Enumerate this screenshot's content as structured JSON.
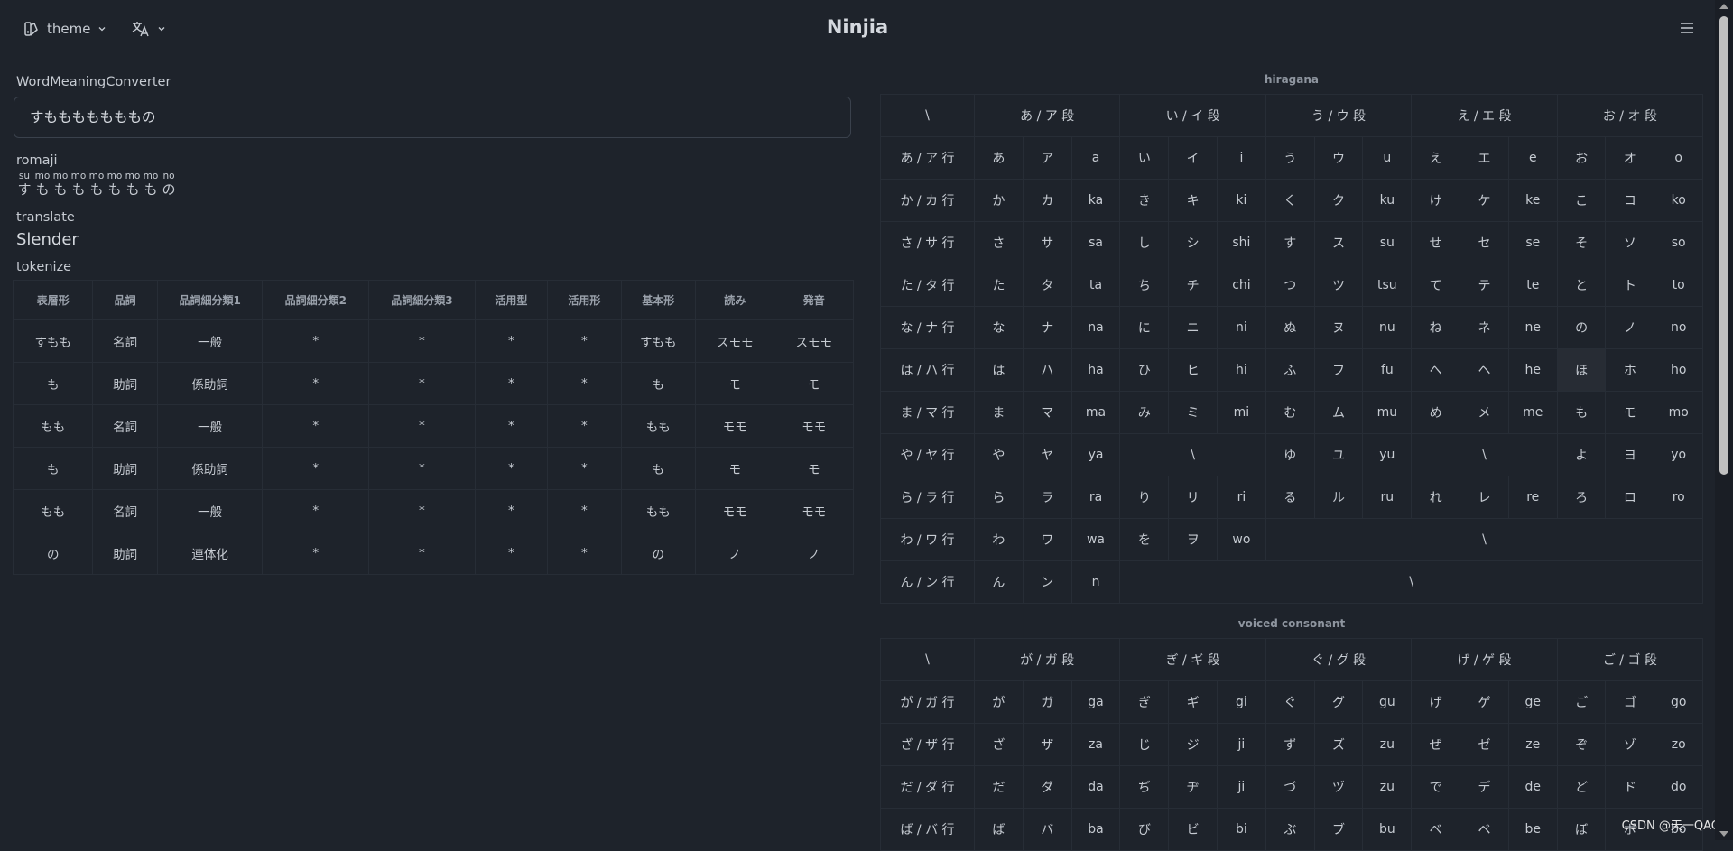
{
  "header": {
    "theme_label": "theme",
    "brand": "Ninjia"
  },
  "converter": {
    "title": "WordMeaningConverter",
    "input_value": "すもももももももの",
    "romaji_label": "romaji",
    "romaji": [
      {
        "rt": "su",
        "k": "す"
      },
      {
        "rt": "mo",
        "k": "も"
      },
      {
        "rt": "mo",
        "k": "も"
      },
      {
        "rt": "mo",
        "k": "も"
      },
      {
        "rt": "mo",
        "k": "も"
      },
      {
        "rt": "mo",
        "k": "も"
      },
      {
        "rt": "mo",
        "k": "も"
      },
      {
        "rt": "mo",
        "k": "も"
      },
      {
        "rt": "no",
        "k": "の"
      }
    ],
    "translate_label": "translate",
    "translation": "Slender",
    "tokenize_label": "tokenize"
  },
  "tokenize": {
    "headers": [
      "表層形",
      "品詞",
      "品詞細分類1",
      "品詞細分類2",
      "品詞細分類3",
      "活用型",
      "活用形",
      "基本形",
      "読み",
      "発音"
    ],
    "rows": [
      [
        "すもも",
        "名詞",
        "一般",
        "*",
        "*",
        "*",
        "*",
        "すもも",
        "スモモ",
        "スモモ"
      ],
      [
        "も",
        "助詞",
        "係助詞",
        "*",
        "*",
        "*",
        "*",
        "も",
        "モ",
        "モ"
      ],
      [
        "もも",
        "名詞",
        "一般",
        "*",
        "*",
        "*",
        "*",
        "もも",
        "モモ",
        "モモ"
      ],
      [
        "も",
        "助詞",
        "係助詞",
        "*",
        "*",
        "*",
        "*",
        "も",
        "モ",
        "モ"
      ],
      [
        "もも",
        "名詞",
        "一般",
        "*",
        "*",
        "*",
        "*",
        "もも",
        "モモ",
        "モモ"
      ],
      [
        "の",
        "助詞",
        "連体化",
        "*",
        "*",
        "*",
        "*",
        "の",
        "ノ",
        "ノ"
      ]
    ]
  },
  "hiragana": {
    "title": "hiragana",
    "headers": [
      "\\",
      "あ / ア 段",
      "い / イ 段",
      "う / ウ 段",
      "え / エ 段",
      "お / オ 段"
    ],
    "rows": [
      {
        "label": "あ / ア 行",
        "cells": [
          [
            "あ",
            "ア",
            "a"
          ],
          [
            "い",
            "イ",
            "i"
          ],
          [
            "う",
            "ウ",
            "u"
          ],
          [
            "え",
            "エ",
            "e"
          ],
          [
            "お",
            "オ",
            "o"
          ]
        ]
      },
      {
        "label": "か / カ 行",
        "cells": [
          [
            "か",
            "カ",
            "ka"
          ],
          [
            "き",
            "キ",
            "ki"
          ],
          [
            "く",
            "ク",
            "ku"
          ],
          [
            "け",
            "ケ",
            "ke"
          ],
          [
            "こ",
            "コ",
            "ko"
          ]
        ]
      },
      {
        "label": "さ / サ 行",
        "cells": [
          [
            "さ",
            "サ",
            "sa"
          ],
          [
            "し",
            "シ",
            "shi"
          ],
          [
            "す",
            "ス",
            "su"
          ],
          [
            "せ",
            "セ",
            "se"
          ],
          [
            "そ",
            "ソ",
            "so"
          ]
        ]
      },
      {
        "label": "た / タ 行",
        "cells": [
          [
            "た",
            "タ",
            "ta"
          ],
          [
            "ち",
            "チ",
            "chi"
          ],
          [
            "つ",
            "ツ",
            "tsu"
          ],
          [
            "て",
            "テ",
            "te"
          ],
          [
            "と",
            "ト",
            "to"
          ]
        ]
      },
      {
        "label": "な / ナ 行",
        "cells": [
          [
            "な",
            "ナ",
            "na"
          ],
          [
            "に",
            "ニ",
            "ni"
          ],
          [
            "ぬ",
            "ヌ",
            "nu"
          ],
          [
            "ね",
            "ネ",
            "ne"
          ],
          [
            "の",
            "ノ",
            "no"
          ]
        ]
      },
      {
        "label": "は / ハ 行",
        "cells": [
          [
            "は",
            "ハ",
            "ha"
          ],
          [
            "ひ",
            "ヒ",
            "hi"
          ],
          [
            "ふ",
            "フ",
            "fu"
          ],
          [
            "へ",
            "ヘ",
            "he"
          ],
          [
            "ほ",
            "ホ",
            "ho"
          ]
        ]
      },
      {
        "label": "ま / マ 行",
        "cells": [
          [
            "ま",
            "マ",
            "ma"
          ],
          [
            "み",
            "ミ",
            "mi"
          ],
          [
            "む",
            "ム",
            "mu"
          ],
          [
            "め",
            "メ",
            "me"
          ],
          [
            "も",
            "モ",
            "mo"
          ]
        ]
      },
      {
        "label": "や / ヤ 行",
        "cells": [
          [
            "や",
            "ヤ",
            "ya"
          ],
          "\\",
          [
            "ゆ",
            "ユ",
            "yu"
          ],
          "\\",
          [
            "よ",
            "ヨ",
            "yo"
          ]
        ]
      },
      {
        "label": "ら / ラ 行",
        "cells": [
          [
            "ら",
            "ラ",
            "ra"
          ],
          [
            "り",
            "リ",
            "ri"
          ],
          [
            "る",
            "ル",
            "ru"
          ],
          [
            "れ",
            "レ",
            "re"
          ],
          [
            "ろ",
            "ロ",
            "ro"
          ]
        ]
      },
      {
        "label": "わ / ワ 行",
        "cells": [
          [
            "わ",
            "ワ",
            "wa"
          ],
          [
            "を",
            "ヲ",
            "wo"
          ],
          "\\",
          "-",
          "-"
        ]
      },
      {
        "label": "ん / ン 行",
        "cells": [
          [
            "ん",
            "ン",
            "n"
          ],
          "\\",
          "-",
          "-",
          "-"
        ]
      }
    ]
  },
  "voiced": {
    "title": "voiced consonant",
    "headers": [
      "\\",
      "が / ガ 段",
      "ぎ / ギ 段",
      "ぐ / グ 段",
      "げ / ゲ 段",
      "ご / ゴ 段"
    ],
    "rows": [
      {
        "label": "が / ガ 行",
        "cells": [
          [
            "が",
            "ガ",
            "ga"
          ],
          [
            "ぎ",
            "ギ",
            "gi"
          ],
          [
            "ぐ",
            "グ",
            "gu"
          ],
          [
            "げ",
            "ゲ",
            "ge"
          ],
          [
            "ご",
            "ゴ",
            "go"
          ]
        ]
      },
      {
        "label": "ざ / ザ 行",
        "cells": [
          [
            "ざ",
            "ザ",
            "za"
          ],
          [
            "じ",
            "ジ",
            "ji"
          ],
          [
            "ず",
            "ズ",
            "zu"
          ],
          [
            "ぜ",
            "ゼ",
            "ze"
          ],
          [
            "ぞ",
            "ゾ",
            "zo"
          ]
        ]
      },
      {
        "label": "だ / ダ 行",
        "cells": [
          [
            "だ",
            "ダ",
            "da"
          ],
          [
            "ぢ",
            "ヂ",
            "ji"
          ],
          [
            "づ",
            "ヅ",
            "zu"
          ],
          [
            "で",
            "デ",
            "de"
          ],
          [
            "ど",
            "ド",
            "do"
          ]
        ]
      },
      {
        "label": "ば / バ 行",
        "cells": [
          [
            "ば",
            "バ",
            "ba"
          ],
          [
            "び",
            "ビ",
            "bi"
          ],
          [
            "ぶ",
            "ブ",
            "bu"
          ],
          [
            "べ",
            "ベ",
            "be"
          ],
          [
            "ぼ",
            "ボ",
            "bo"
          ]
        ]
      }
    ]
  },
  "footer": "CSDN @天一QAQ"
}
